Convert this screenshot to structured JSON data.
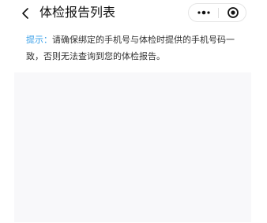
{
  "header": {
    "title": "体检报告列表",
    "back_icon": "chevron-left-icon",
    "more_icon": "more-dots-icon",
    "close_icon": "target-circle-icon"
  },
  "notice": {
    "label": "提示：",
    "line1": "请确保绑定的手机号与体检时提供的手机号码一",
    "line2": "致，否则无法查询到您的体检报告。",
    "label_color": "#3aa0e8"
  },
  "colors": {
    "list_background": "#f8f8fa",
    "text": "#333333"
  }
}
